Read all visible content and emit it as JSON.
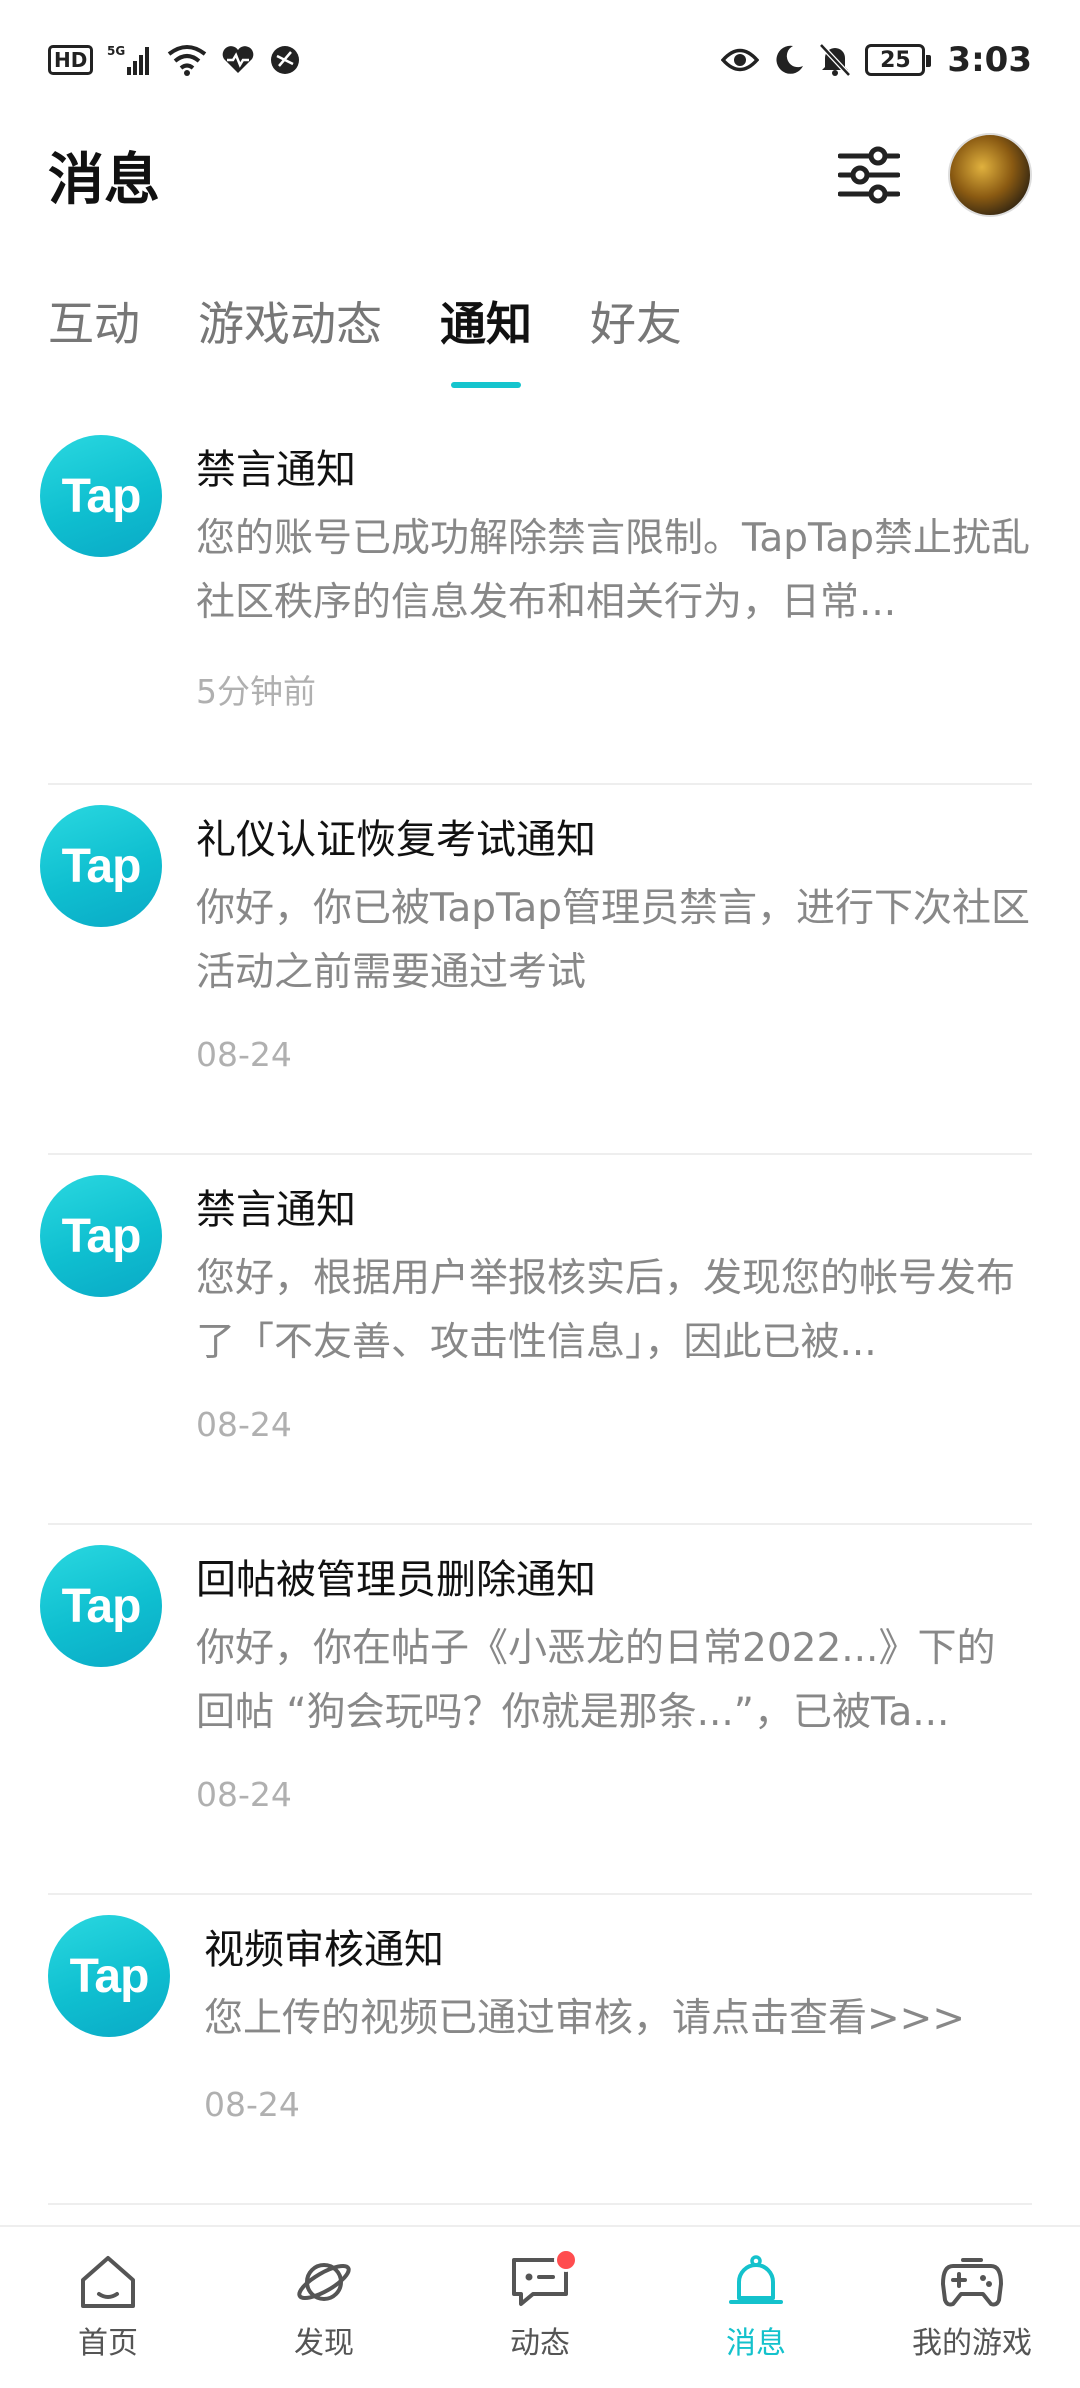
{
  "statusbar": {
    "left_badge": "HD",
    "network": "5G",
    "battery": "25",
    "time": "3:03"
  },
  "header": {
    "title": "消息"
  },
  "tabs": [
    {
      "label": "互动"
    },
    {
      "label": "游戏动态"
    },
    {
      "label": "通知",
      "active": true
    },
    {
      "label": "好友"
    }
  ],
  "logo_text": "Tap",
  "notifications": [
    {
      "title": "禁言通知",
      "body": "您的账号已成功解除禁言限制。TapTap禁止扰乱社区秩序的信息发布和相关行为，日常...",
      "time": "5分钟前"
    },
    {
      "title": "礼仪认证恢复考试通知",
      "body": "你好，你已被TapTap管理员禁言，进行下次社区活动之前需要通过考试",
      "time": "08-24"
    },
    {
      "title": "禁言通知",
      "body": "您好，根据用户举报核实后，发现您的帐号发布了「不友善、攻击性信息」，因此已被...",
      "time": "08-24"
    },
    {
      "title": "回帖被管理员删除通知",
      "body": "你好，你在帖子《小恶龙的日常2022...》下的回帖 “狗会玩吗？你就是那条...”，已被Ta...",
      "time": "08-24"
    },
    {
      "title": "视频审核通知",
      "body": "您上传的视频已通过审核，请点击查看>>>",
      "time": "08-24"
    }
  ],
  "bottom_nav": [
    {
      "label": "首页",
      "icon": "home-icon"
    },
    {
      "label": "发现",
      "icon": "planet-icon"
    },
    {
      "label": "动态",
      "icon": "chat-icon"
    },
    {
      "label": "消息",
      "icon": "bell-icon",
      "active": true
    },
    {
      "label": "我的游戏",
      "icon": "gamepad-icon"
    }
  ],
  "colors": {
    "accent": "#14c2cc",
    "badge": "#ff4d4f"
  }
}
